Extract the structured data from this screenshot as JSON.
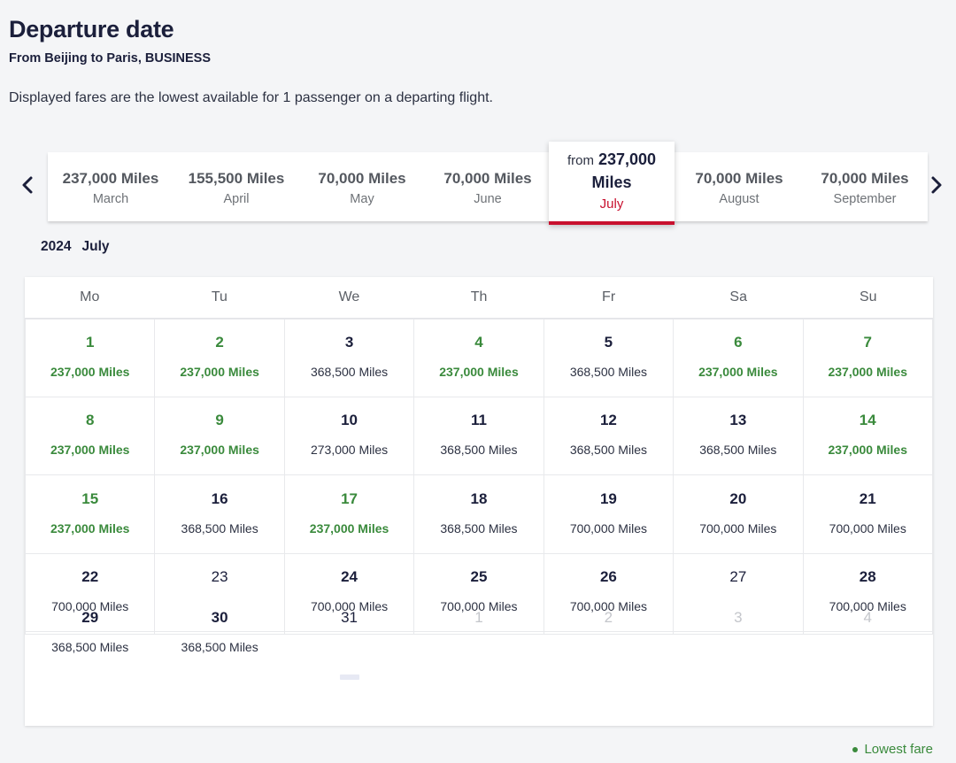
{
  "header": {
    "title": "Departure date",
    "subtitle": "From Beijing to Paris, BUSINESS",
    "description": "Displayed fares are the lowest available for 1 passenger on a departing flight."
  },
  "carousel": {
    "prev_icon": "chevron-left-icon",
    "next_icon": "chevron-right-icon",
    "from_label": "from",
    "months": [
      {
        "price": "237,000 Miles",
        "name": "March",
        "selected": false
      },
      {
        "price": "155,500 Miles",
        "name": "April",
        "selected": false
      },
      {
        "price": "70,000 Miles",
        "name": "May",
        "selected": false
      },
      {
        "price": "70,000 Miles",
        "name": "June",
        "selected": false
      },
      {
        "price": "237,000 Miles",
        "name": "July",
        "selected": true
      },
      {
        "price": "70,000 Miles",
        "name": "August",
        "selected": false
      },
      {
        "price": "70,000 Miles",
        "name": "September",
        "selected": false
      }
    ]
  },
  "calendar": {
    "year": "2024",
    "month": "July",
    "weekdays": [
      "Mo",
      "Tu",
      "We",
      "Th",
      "Fr",
      "Sa",
      "Su"
    ],
    "weeks": [
      [
        {
          "day": "1",
          "fare": "237,000 Miles",
          "state": "lowest"
        },
        {
          "day": "2",
          "fare": "237,000 Miles",
          "state": "lowest"
        },
        {
          "day": "3",
          "fare": "368,500 Miles",
          "state": "normal"
        },
        {
          "day": "4",
          "fare": "237,000 Miles",
          "state": "lowest"
        },
        {
          "day": "5",
          "fare": "368,500 Miles",
          "state": "normal"
        },
        {
          "day": "6",
          "fare": "237,000 Miles",
          "state": "lowest"
        },
        {
          "day": "7",
          "fare": "237,000 Miles",
          "state": "lowest"
        }
      ],
      [
        {
          "day": "8",
          "fare": "237,000 Miles",
          "state": "lowest"
        },
        {
          "day": "9",
          "fare": "237,000 Miles",
          "state": "lowest"
        },
        {
          "day": "10",
          "fare": "273,000 Miles",
          "state": "normal"
        },
        {
          "day": "11",
          "fare": "368,500 Miles",
          "state": "normal"
        },
        {
          "day": "12",
          "fare": "368,500 Miles",
          "state": "normal"
        },
        {
          "day": "13",
          "fare": "368,500 Miles",
          "state": "normal"
        },
        {
          "day": "14",
          "fare": "237,000 Miles",
          "state": "lowest"
        }
      ],
      [
        {
          "day": "15",
          "fare": "237,000 Miles",
          "state": "lowest"
        },
        {
          "day": "16",
          "fare": "368,500 Miles",
          "state": "normal"
        },
        {
          "day": "17",
          "fare": "237,000 Miles",
          "state": "lowest"
        },
        {
          "day": "18",
          "fare": "368,500 Miles",
          "state": "normal"
        },
        {
          "day": "19",
          "fare": "700,000 Miles",
          "state": "normal"
        },
        {
          "day": "20",
          "fare": "700,000 Miles",
          "state": "normal"
        },
        {
          "day": "21",
          "fare": "700,000 Miles",
          "state": "normal"
        }
      ],
      [
        {
          "day": "22",
          "fare": "700,000 Miles",
          "state": "normal"
        },
        {
          "day": "23",
          "fare": "",
          "state": "nofare"
        },
        {
          "day": "24",
          "fare": "700,000 Miles",
          "state": "normal"
        },
        {
          "day": "25",
          "fare": "700,000 Miles",
          "state": "normal"
        },
        {
          "day": "26",
          "fare": "700,000 Miles",
          "state": "normal"
        },
        {
          "day": "27",
          "fare": "",
          "state": "nofare"
        },
        {
          "day": "28",
          "fare": "700,000 Miles",
          "state": "normal"
        }
      ],
      [
        {
          "day": "29",
          "fare": "368,500 Miles",
          "state": "normal"
        },
        {
          "day": "30",
          "fare": "368,500 Miles",
          "state": "normal"
        },
        {
          "day": "31",
          "fare": "",
          "state": "loading"
        },
        {
          "day": "1",
          "fare": "",
          "state": "muted"
        },
        {
          "day": "2",
          "fare": "",
          "state": "muted"
        },
        {
          "day": "3",
          "fare": "",
          "state": "muted"
        },
        {
          "day": "4",
          "fare": "",
          "state": "muted"
        }
      ]
    ]
  },
  "legend": {
    "text": "Lowest fare"
  },
  "colors": {
    "lowest_fare_green": "#3a8a3c",
    "accent_red": "#c8102e",
    "text_navy": "#1b1f3b",
    "page_bg": "#f4f5f7"
  }
}
